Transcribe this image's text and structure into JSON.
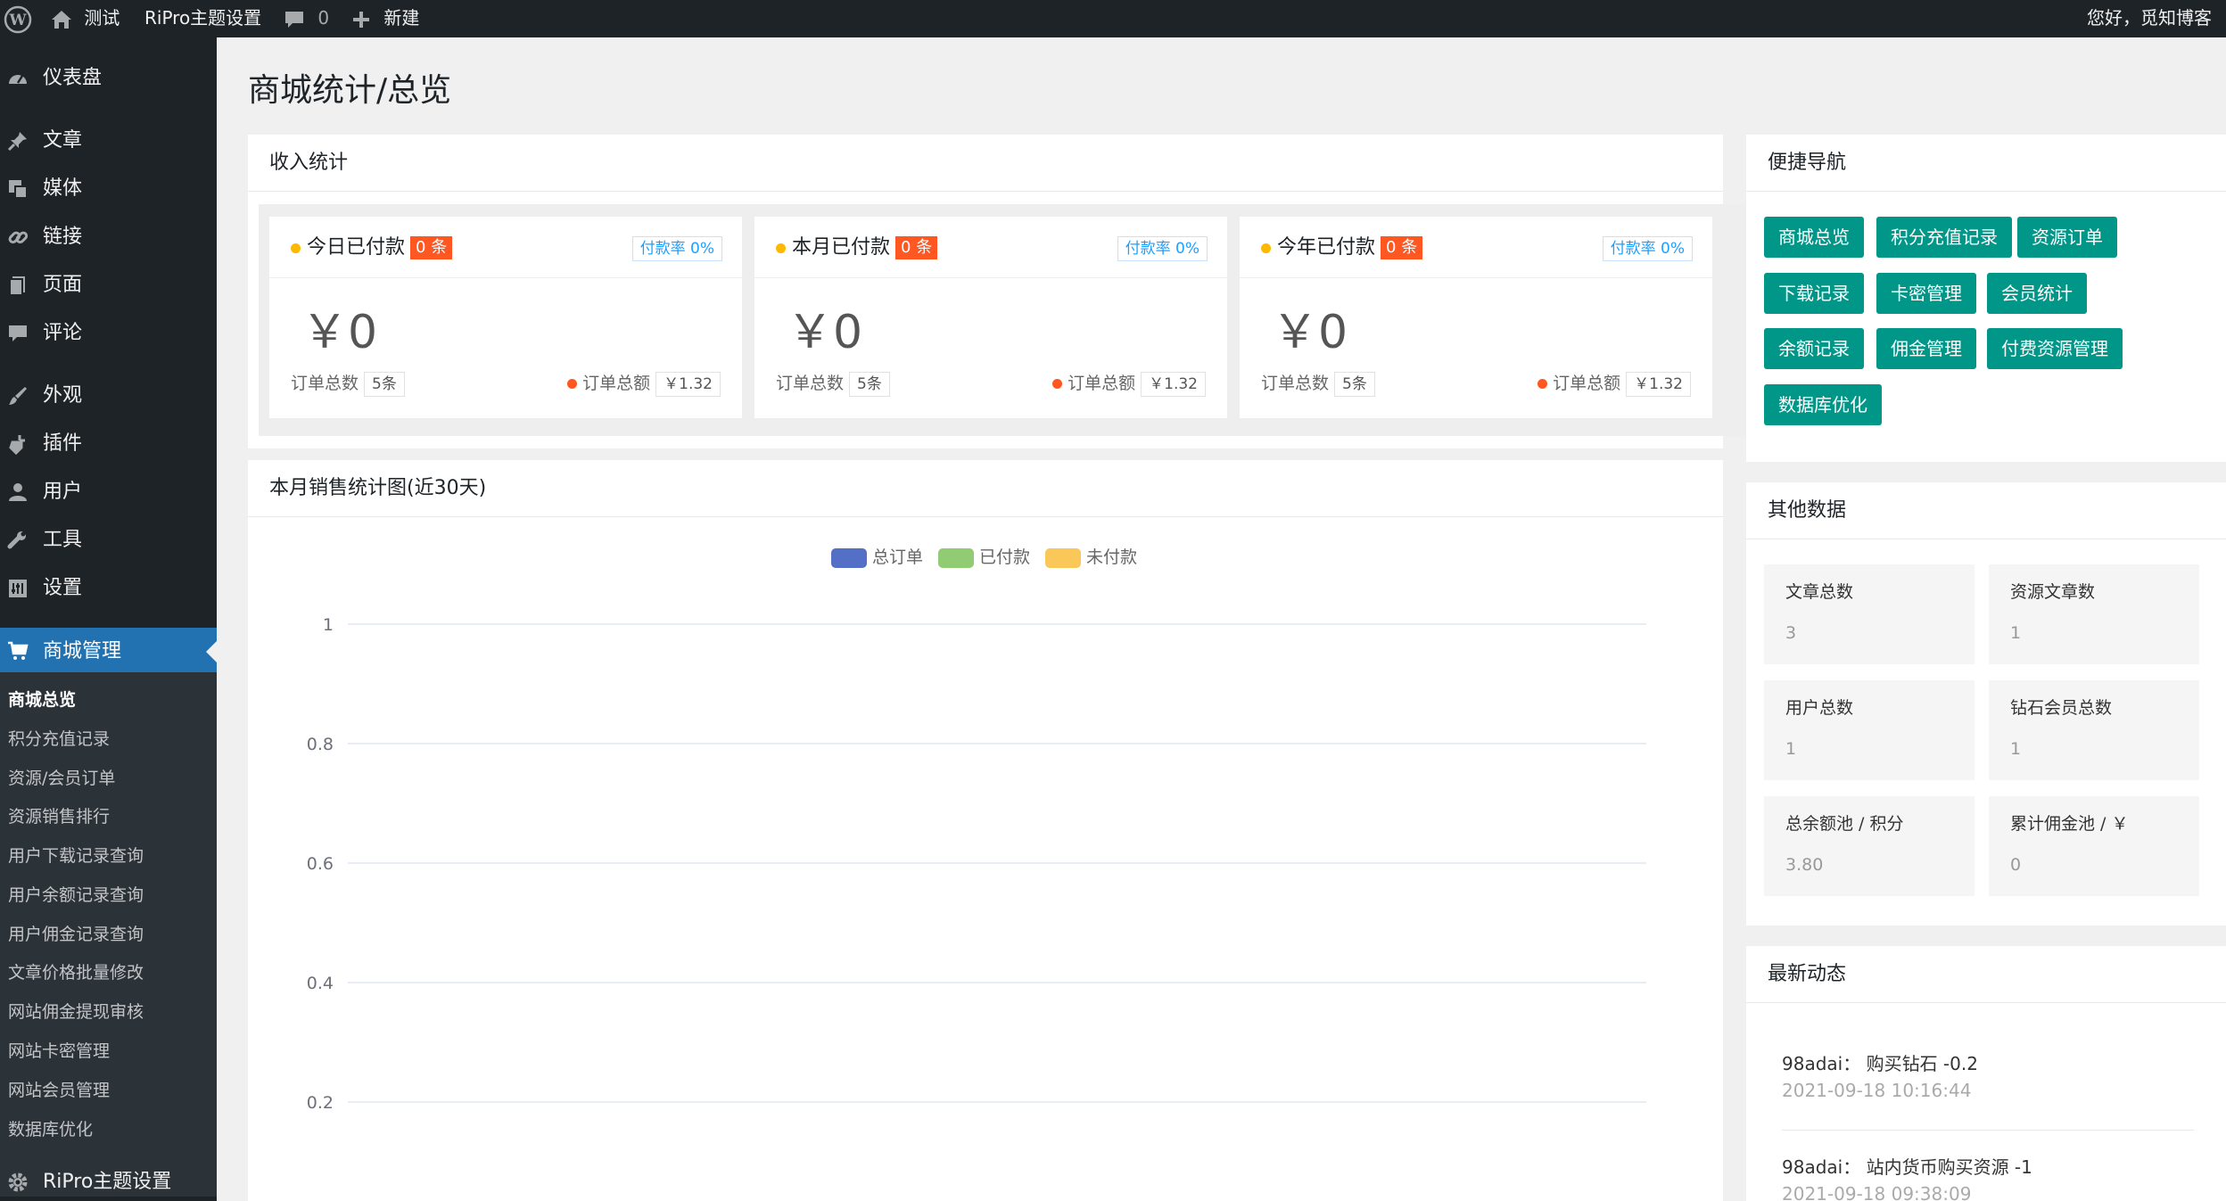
{
  "adminbar": {
    "site_name": "测试",
    "theme_settings": "RiPro主题设置",
    "comments_count": "0",
    "new_label": "新建",
    "greeting": "您好，觅知博客"
  },
  "sidebar": {
    "items": [
      {
        "label": "仪表盘",
        "icon": "dashboard-icon"
      },
      {
        "label": "文章",
        "icon": "pin-icon"
      },
      {
        "label": "媒体",
        "icon": "media-icon"
      },
      {
        "label": "链接",
        "icon": "link-icon"
      },
      {
        "label": "页面",
        "icon": "page-icon"
      },
      {
        "label": "评论",
        "icon": "comment-icon"
      },
      {
        "label": "外观",
        "icon": "brush-icon"
      },
      {
        "label": "插件",
        "icon": "plugin-icon"
      },
      {
        "label": "用户",
        "icon": "user-icon"
      },
      {
        "label": "工具",
        "icon": "wrench-icon"
      },
      {
        "label": "设置",
        "icon": "settings-icon"
      },
      {
        "label": "商城管理",
        "icon": "cart-icon"
      },
      {
        "label": "RiPro主题设置",
        "icon": "gear-icon"
      }
    ],
    "submenu": [
      "商城总览",
      "积分充值记录",
      "资源/会员订单",
      "资源销售排行",
      "用户下载记录查询",
      "用户余额记录查询",
      "用户佣金记录查询",
      "文章价格批量修改",
      "网站佣金提现审核",
      "网站卡密管理",
      "网站会员管理",
      "数据库优化"
    ]
  },
  "page": {
    "title": "商城统计/总览"
  },
  "income": {
    "title": "收入统计",
    "cards": [
      {
        "title": "今日已付款",
        "count_badge": "0 条",
        "rate": "付款率 0%",
        "amount": "￥0",
        "orders_label": "订单总数",
        "orders_value": "5条",
        "total_label": "订单总额",
        "total_value": "￥1.32"
      },
      {
        "title": "本月已付款",
        "count_badge": "0 条",
        "rate": "付款率 0%",
        "amount": "￥0",
        "orders_label": "订单总数",
        "orders_value": "5条",
        "total_label": "订单总额",
        "total_value": "￥1.32"
      },
      {
        "title": "今年已付款",
        "count_badge": "0 条",
        "rate": "付款率 0%",
        "amount": "￥0",
        "orders_label": "订单总数",
        "orders_value": "5条",
        "total_label": "订单总额",
        "total_value": "￥1.32"
      }
    ]
  },
  "sales_chart": {
    "title": "本月销售统计图(近30天)"
  },
  "chart_data": {
    "type": "line",
    "series": [
      {
        "name": "总订单",
        "color": "#5470c6",
        "values": []
      },
      {
        "name": "已付款",
        "color": "#91cc75",
        "values": []
      },
      {
        "name": "未付款",
        "color": "#fac858",
        "values": []
      }
    ],
    "yticks": [
      "1",
      "0.8",
      "0.6",
      "0.4",
      "0.2"
    ],
    "ylim": [
      0,
      1
    ],
    "grid": true,
    "legend": "top-center"
  },
  "quick_nav": {
    "title": "便捷导航",
    "buttons": [
      "商城总览",
      "积分充值记录",
      "资源订单",
      "下载记录",
      "卡密管理",
      "会员统计",
      "余额记录",
      "佣金管理",
      "付费资源管理",
      "数据库优化"
    ]
  },
  "other_data": {
    "title": "其他数据",
    "items": [
      {
        "label": "文章总数",
        "value": "3"
      },
      {
        "label": "资源文章数",
        "value": "1"
      },
      {
        "label": "用户总数",
        "value": "1"
      },
      {
        "label": "钻石会员总数",
        "value": "1"
      },
      {
        "label": "总余额池 / 积分",
        "value": "3.80"
      },
      {
        "label": "累计佣金池 / ￥",
        "value": "0"
      }
    ]
  },
  "activity": {
    "title": "最新动态",
    "items": [
      {
        "text": "98adai： 购买钻石 -0.2",
        "time": "2021-09-18 10:16:44"
      },
      {
        "text": "98adai： 站内货币购买资源 -1",
        "time": "2021-09-18 09:38:09"
      }
    ]
  },
  "colors": {
    "accent": "#2271b1",
    "nav_button": "#009688",
    "badge": "#fe5722",
    "rate": "#1e9fff",
    "dot_yellow": "#ffb800",
    "dot_orange": "#fe5722"
  }
}
